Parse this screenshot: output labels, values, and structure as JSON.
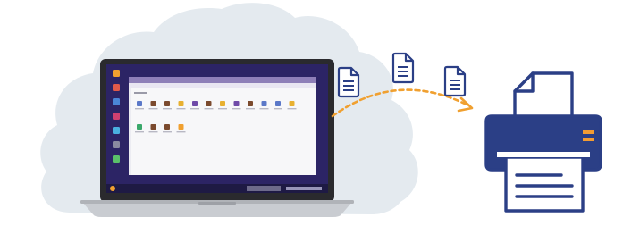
{
  "scene": {
    "cloud_color": "#e4eaef",
    "arrow_color": "#f0a030",
    "printer_color": "#2b3f86",
    "printer_accent": "#f39c33",
    "document_icon_count": 3
  },
  "desktop": {
    "wallpaper_color": "#2c2465",
    "window_title_color": "#8e7fb8",
    "taskbar_color": "#1e1a44",
    "explorer_icons": [
      {
        "icon": "blue-app",
        "color": "#5b78c8"
      },
      {
        "icon": "brown-app",
        "color": "#7b4a2e"
      },
      {
        "icon": "brown-app",
        "color": "#7b4a2e"
      },
      {
        "icon": "yellow-app",
        "color": "#e8b030"
      },
      {
        "icon": "purple-app",
        "color": "#6f4aa8"
      },
      {
        "icon": "brown-app",
        "color": "#7b4a2e"
      },
      {
        "icon": "yellow-app",
        "color": "#e8b030"
      },
      {
        "icon": "purple-app",
        "color": "#6f4aa8"
      },
      {
        "icon": "brown-app",
        "color": "#7b4a2e"
      },
      {
        "icon": "blue-app",
        "color": "#5b78c8"
      },
      {
        "icon": "blue-app",
        "color": "#5b78c8"
      },
      {
        "icon": "yellow-app",
        "color": "#e8b030"
      },
      {
        "icon": "green-app",
        "color": "#3aa86b"
      },
      {
        "icon": "brown-app",
        "color": "#7b4a2e"
      },
      {
        "icon": "brown-app",
        "color": "#7b4a2e"
      },
      {
        "icon": "browser-e-app",
        "color": "#f0a030"
      }
    ]
  }
}
